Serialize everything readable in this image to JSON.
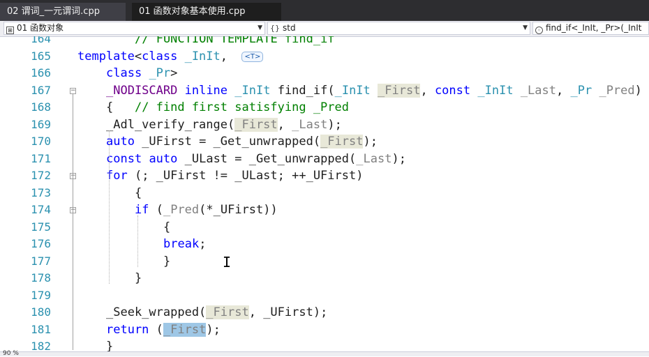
{
  "tabs": [
    {
      "label": "02 谓词_一元谓词.cpp"
    },
    {
      "label": "01 函数对象基本使用.cpp"
    }
  ],
  "nav": {
    "project": "01 函数对象",
    "scope": "std",
    "member": "find_if<_InIt, _Pr>(_InIt"
  },
  "status": {
    "zoom": "90 %"
  },
  "lines": [
    {
      "n": "164",
      "indent": 2,
      "tokens": [
        {
          "t": "// FUNCTION TEMPLATE find_if",
          "c": "c"
        }
      ]
    },
    {
      "n": "165",
      "indent": 0,
      "tokens": [
        {
          "t": "template",
          "c": "k"
        },
        {
          "t": "<"
        },
        {
          "t": "class",
          "c": "k"
        },
        {
          "t": " "
        },
        {
          "t": "_InIt",
          "c": "t"
        },
        {
          "t": ",  "
        }
      ],
      "badge": "<T>"
    },
    {
      "n": "166",
      "indent": 1,
      "tokens": [
        {
          "t": "class",
          "c": "k"
        },
        {
          "t": " "
        },
        {
          "t": "_Pr",
          "c": "t"
        },
        {
          "t": ">"
        }
      ]
    },
    {
      "n": "167",
      "indent": 1,
      "fold": "-",
      "tokens": [
        {
          "t": "_NODISCARD",
          "c": "m"
        },
        {
          "t": " "
        },
        {
          "t": "inline",
          "c": "k"
        },
        {
          "t": " "
        },
        {
          "t": "_InIt",
          "c": "t"
        },
        {
          "t": " find_if("
        },
        {
          "t": "_InIt",
          "c": "t"
        },
        {
          "t": " "
        },
        {
          "t": "_First",
          "c": "p",
          "hl": true
        },
        {
          "t": ", "
        },
        {
          "t": "const",
          "c": "k"
        },
        {
          "t": " "
        },
        {
          "t": "_InIt",
          "c": "t"
        },
        {
          "t": " "
        },
        {
          "t": "_Last",
          "c": "p"
        },
        {
          "t": ", "
        },
        {
          "t": "_Pr",
          "c": "t"
        },
        {
          "t": " "
        },
        {
          "t": "_Pred",
          "c": "p"
        },
        {
          "t": ")"
        }
      ]
    },
    {
      "n": "168",
      "indent": 1,
      "tokens": [
        {
          "t": "{   "
        },
        {
          "t": "// find first satisfying _Pred",
          "c": "c"
        }
      ]
    },
    {
      "n": "169",
      "indent": 1,
      "tokens": [
        {
          "t": "_Adl_verify_range("
        },
        {
          "t": "_First",
          "c": "p",
          "hl": true
        },
        {
          "t": ", "
        },
        {
          "t": "_Last",
          "c": "p"
        },
        {
          "t": ");"
        }
      ]
    },
    {
      "n": "170",
      "indent": 1,
      "tokens": [
        {
          "t": "auto",
          "c": "k"
        },
        {
          "t": " _UFirst = _Get_unwrapped("
        },
        {
          "t": "_First",
          "c": "p",
          "hl": true
        },
        {
          "t": ");"
        }
      ]
    },
    {
      "n": "171",
      "indent": 1,
      "tokens": [
        {
          "t": "const",
          "c": "k"
        },
        {
          "t": " "
        },
        {
          "t": "auto",
          "c": "k"
        },
        {
          "t": " _ULast = _Get_unwrapped("
        },
        {
          "t": "_Last",
          "c": "p"
        },
        {
          "t": ");"
        }
      ]
    },
    {
      "n": "172",
      "indent": 1,
      "fold": "-",
      "tokens": [
        {
          "t": "for",
          "c": "k"
        },
        {
          "t": " (; _UFirst != _ULast; ++_UFirst)"
        }
      ]
    },
    {
      "n": "173",
      "indent": 2,
      "tokens": [
        {
          "t": "{"
        }
      ]
    },
    {
      "n": "174",
      "indent": 2,
      "fold": "-",
      "tokens": [
        {
          "t": "if",
          "c": "k"
        },
        {
          "t": " ("
        },
        {
          "t": "_Pred",
          "c": "p"
        },
        {
          "t": "(*_UFirst))"
        }
      ]
    },
    {
      "n": "175",
      "indent": 3,
      "tokens": [
        {
          "t": "{"
        }
      ]
    },
    {
      "n": "176",
      "indent": 3,
      "tokens": [
        {
          "t": "break",
          "c": "k"
        },
        {
          "t": ";"
        }
      ]
    },
    {
      "n": "177",
      "indent": 3,
      "tokens": [
        {
          "t": "}"
        }
      ]
    },
    {
      "n": "178",
      "indent": 2,
      "tokens": [
        {
          "t": "}"
        }
      ]
    },
    {
      "n": "179",
      "indent": 0,
      "tokens": []
    },
    {
      "n": "180",
      "indent": 1,
      "tokens": [
        {
          "t": "_Seek_wrapped("
        },
        {
          "t": "_First",
          "c": "p",
          "hl": true
        },
        {
          "t": ", _UFirst);"
        }
      ]
    },
    {
      "n": "181",
      "indent": 1,
      "tokens": [
        {
          "t": "return",
          "c": "k"
        },
        {
          "t": " ("
        },
        {
          "t": "_First",
          "c": "p",
          "sel": true
        },
        {
          "t": ");"
        }
      ]
    },
    {
      "n": "182",
      "indent": 1,
      "tokens": [
        {
          "t": "}"
        }
      ]
    }
  ],
  "colors": {
    "keyword": "#0000ff",
    "comment": "#008000",
    "param": "#808080",
    "type": "#2b91af",
    "macro": "#6f008a",
    "line_number": "#2b91af"
  }
}
